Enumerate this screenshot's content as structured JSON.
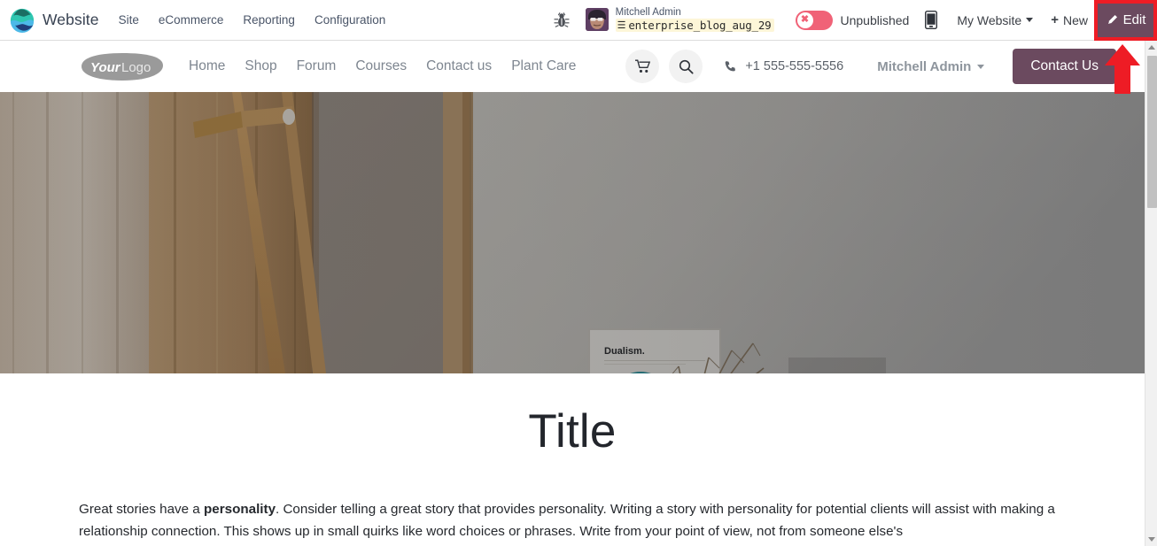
{
  "app": {
    "icon": "website-app-icon",
    "name": "Website",
    "menus": [
      "Site",
      "eCommerce",
      "Reporting",
      "Configuration"
    ]
  },
  "systray": {
    "debug_icon": "bug-icon",
    "user": {
      "avatar": "user-avatar",
      "name": "Mitchell Admin",
      "db_icon": "database-icon",
      "database": "enterprise_blog_aug_29"
    },
    "publish": {
      "state_label": "Unpublished",
      "toggle_icon": "x-circle-icon",
      "toggle_color": "#f06277"
    },
    "mobile_preview_icon": "mobile-phone-icon",
    "website_selector": {
      "label": "My Website",
      "caret_icon": "chevron-down-icon"
    },
    "new_button": {
      "plus_icon": "plus-icon",
      "label": "New"
    },
    "edit_button": {
      "pencil_icon": "pencil-icon",
      "label": "Edit",
      "background": "#6b4a5f",
      "highlight_color": "#ee1c25"
    }
  },
  "site_header": {
    "logo": {
      "primary": "Your",
      "secondary": "Logo"
    },
    "nav": [
      "Home",
      "Shop",
      "Forum",
      "Courses",
      "Contact us",
      "Plant Care"
    ],
    "cart_icon": "shopping-cart-icon",
    "search_icon": "search-icon",
    "phone_icon": "phone-icon",
    "phone": "+1 555-555-5556",
    "user_menu": {
      "label": "Mitchell Admin",
      "caret_icon": "chevron-down-icon"
    },
    "cta": {
      "label": "Contact Us",
      "background": "#6b4a5f"
    }
  },
  "hero": {
    "name": "hero-banner-image",
    "poster_caption": "Dualism."
  },
  "page": {
    "title": "Title",
    "paragraph_lead": "Great stories have a ",
    "paragraph_bold": "personality",
    "paragraph_rest": ". Consider telling a great story that provides personality. Writing a story with personality for potential clients will assist with making a relationship connection. This shows up in small quirks like word choices or phrases. Write from your point of view, not from someone else's"
  },
  "scrollbar": {
    "up_icon": "scroll-up-arrow-icon",
    "down_icon": "scroll-down-arrow-icon",
    "thumb": "scrollbar-thumb"
  },
  "annotation": {
    "arrow": "red-up-arrow-annotation",
    "color": "#ee1c25"
  }
}
